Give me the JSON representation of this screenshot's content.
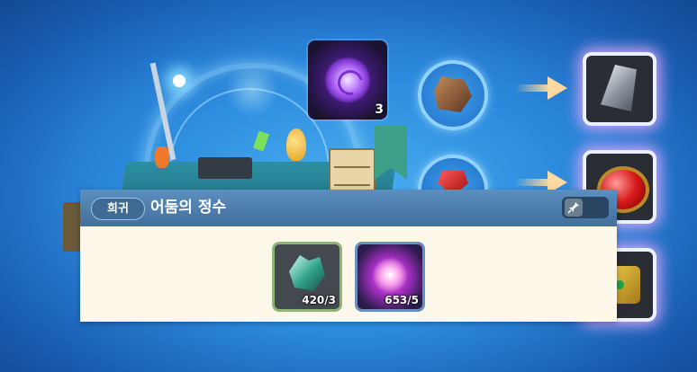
{
  "crafting": {
    "material": {
      "icon": "dark-essence-orb-icon",
      "count": "3"
    },
    "inputs": [
      {
        "icon": "brown-ore-icon"
      },
      {
        "icon": "ruby-ore-icon"
      }
    ],
    "results": [
      {
        "icon": "stone-icon"
      },
      {
        "icon": "red-gem-icon"
      },
      {
        "icon": "gold-dice-icon"
      }
    ]
  },
  "tooltip": {
    "rarity": "희귀",
    "item_name": "어둠의 정수",
    "pin_icon": "pin-icon",
    "ingredients": [
      {
        "icon": "crystal-cluster-icon",
        "count": "420/3",
        "border_color": "#8fb878"
      },
      {
        "icon": "pink-swirl-orb-icon",
        "count": "653/5",
        "border_color": "#6a8fbd"
      }
    ]
  },
  "colors": {
    "background": "#2f8fe0",
    "header": "#4f82b0",
    "panel": "#fdf8ea"
  }
}
